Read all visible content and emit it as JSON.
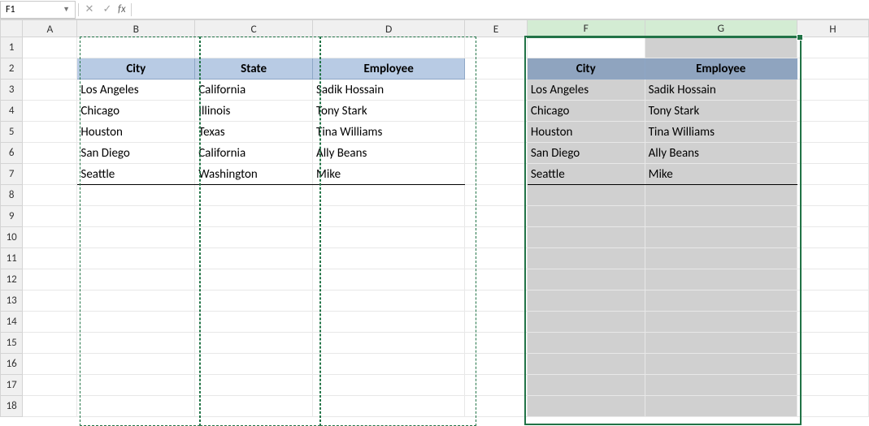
{
  "namebox": {
    "value": "F1"
  },
  "fx_btn_cancel": "✕",
  "fx_btn_enter": "✓",
  "fx_label": "fx",
  "formula_input": "",
  "col_labels": {
    "A": "A",
    "B": "B",
    "C": "C",
    "D": "D",
    "E": "E",
    "F": "F",
    "G": "G",
    "H": "H"
  },
  "row_labels": [
    "1",
    "2",
    "3",
    "4",
    "5",
    "6",
    "7",
    "8",
    "9",
    "10",
    "11",
    "12",
    "13",
    "14",
    "15",
    "16",
    "17",
    "18"
  ],
  "table1": {
    "headers": {
      "city": "City",
      "state": "State",
      "employee": "Employee"
    },
    "rows": [
      {
        "city": "Los Angeles",
        "state": "California",
        "employee": "Sadik Hossain"
      },
      {
        "city": "Chicago",
        "state": "Illinois",
        "employee": "Tony Stark"
      },
      {
        "city": "Houston",
        "state": "Texas",
        "employee": "Tina Williams"
      },
      {
        "city": "San Diego",
        "state": "California",
        "employee": "Ally Beans"
      },
      {
        "city": "Seattle",
        "state": "Washington",
        "employee": "Mike"
      }
    ]
  },
  "table2": {
    "headers": {
      "city": "City",
      "employee": "Employee"
    },
    "rows": [
      {
        "city": "Los Angeles",
        "employee": "Sadik Hossain"
      },
      {
        "city": "Chicago",
        "employee": "Tony Stark"
      },
      {
        "city": "Houston",
        "employee": "Tina Williams"
      },
      {
        "city": "San Diego",
        "employee": "Ally Beans"
      },
      {
        "city": "Seattle",
        "employee": "Mike"
      }
    ]
  }
}
